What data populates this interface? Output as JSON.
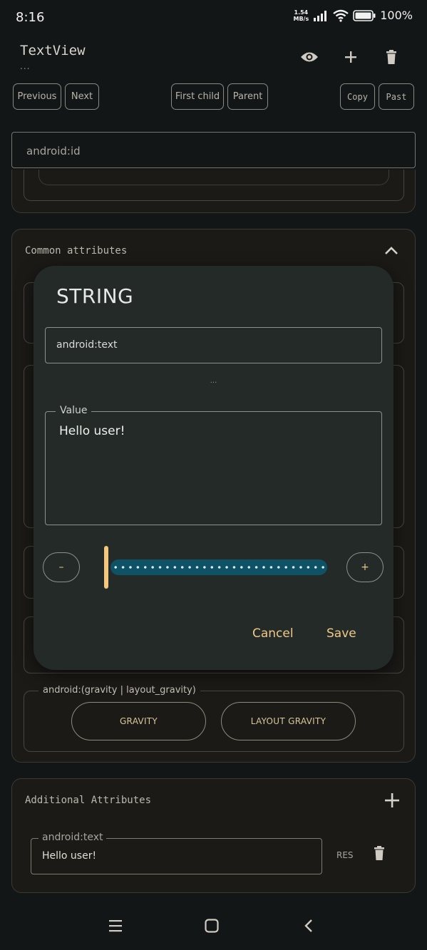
{
  "status_bar": {
    "time": "8:16",
    "net_speed_value": "1.54",
    "net_speed_unit": "MB/s",
    "battery": "100%"
  },
  "header": {
    "title": "TextView",
    "subtitle": "...",
    "icons": [
      "eye-icon",
      "plus-icon",
      "trash-icon"
    ]
  },
  "toolbar": {
    "previous": "Previous",
    "next": "Next",
    "first_child": "First child",
    "parent": "Parent",
    "copy": "Copy",
    "paste": "Past"
  },
  "id_field": {
    "value": "android:id"
  },
  "common_attributes": {
    "title": "Common attributes",
    "gravity_group_label": "android:(gravity | layout_gravity)",
    "gravity_button": "GRAVITY",
    "layout_gravity_button": "LAYOUT GRAVITY"
  },
  "dialog": {
    "title": "STRING",
    "attribute_name": "android:text",
    "ellipsis": "...",
    "value_label": "Value",
    "value_text": "Hello user!",
    "decrement_label": "–",
    "increment_label": "+",
    "slider_position": 0,
    "cancel": "Cancel",
    "save": "Save"
  },
  "additional_attributes": {
    "title": "Additional Attributes",
    "items": [
      {
        "name": "android:text",
        "value": "Hello user!",
        "res_label": "RES"
      }
    ]
  },
  "colors": {
    "background": "#131616",
    "dialog": "#232a28",
    "accent": "#f0c987",
    "slider_track": "#0f5266"
  }
}
